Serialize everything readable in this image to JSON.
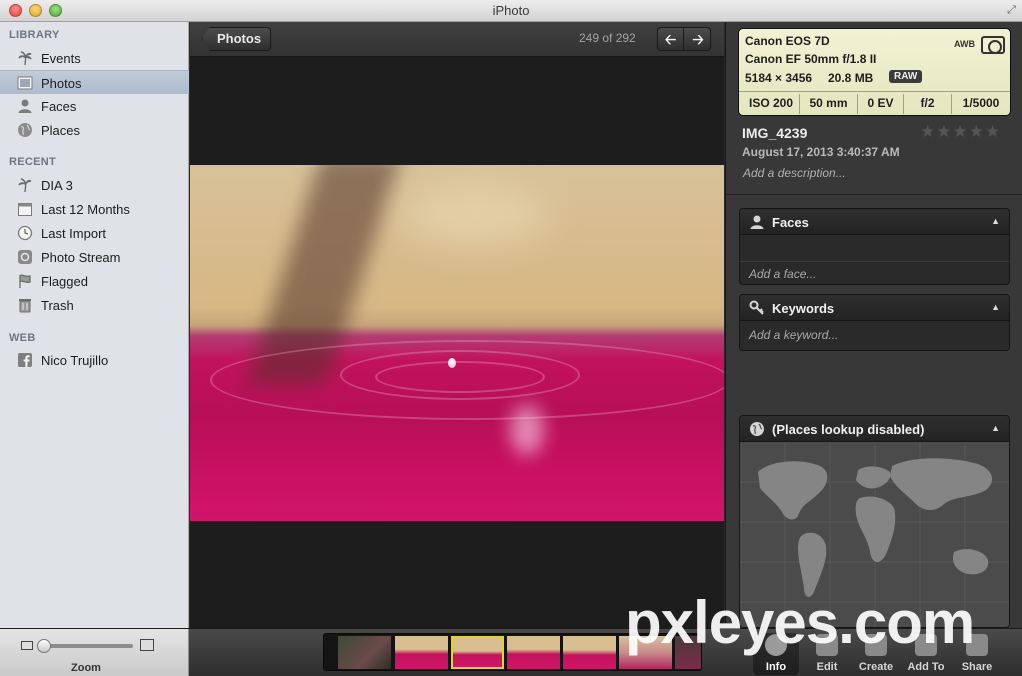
{
  "window": {
    "title": "iPhoto"
  },
  "sidebar": {
    "sections": [
      {
        "label": "LIBRARY"
      },
      {
        "label": "RECENT"
      },
      {
        "label": "WEB"
      }
    ],
    "library": [
      {
        "label": "Events",
        "icon": "palm-tree-icon"
      },
      {
        "label": "Photos",
        "icon": "photo-icon",
        "selected": true
      },
      {
        "label": "Faces",
        "icon": "person-icon"
      },
      {
        "label": "Places",
        "icon": "globe-icon"
      }
    ],
    "recent": [
      {
        "label": "DIA 3",
        "icon": "palm-tree-icon"
      },
      {
        "label": "Last 12 Months",
        "icon": "calendar-icon"
      },
      {
        "label": "Last Import",
        "icon": "clock-icon"
      },
      {
        "label": "Photo Stream",
        "icon": "photo-stream-icon"
      },
      {
        "label": "Flagged",
        "icon": "flag-icon"
      },
      {
        "label": "Trash",
        "icon": "trash-icon"
      }
    ],
    "web": [
      {
        "label": "Nico Trujillo",
        "icon": "facebook-icon"
      }
    ]
  },
  "viewer": {
    "back_label": "Photos",
    "counter": "249 of 292"
  },
  "info": {
    "camera": "Canon EOS 7D",
    "lens": "Canon EF 50mm f/1.8 II",
    "dimensions": "5184 × 3456",
    "file_size": "20.8 MB",
    "format_badge": "RAW",
    "white_balance": "AWB",
    "iso": "ISO 200",
    "focal_length": "50 mm",
    "exposure_bias": "0 EV",
    "aperture": "f/2",
    "shutter": "1/5000",
    "name": "IMG_4239",
    "rating_stars": "★★★★★",
    "date": "August 17, 2013 3:40:37 AM",
    "description_placeholder": "Add a description...",
    "faces": {
      "title": "Faces",
      "hint": "Add a face..."
    },
    "keywords": {
      "title": "Keywords",
      "hint": "Add a keyword..."
    },
    "places": {
      "title": "(Places lookup disabled)"
    }
  },
  "bottom": {
    "zoom_label": "Zoom",
    "zoom_level": 0.05,
    "toolbar": [
      {
        "label": "Info",
        "icon": "info-icon",
        "active": true
      },
      {
        "label": "Edit",
        "icon": "edit-icon"
      },
      {
        "label": "Create",
        "icon": "create-icon"
      },
      {
        "label": "Add To",
        "icon": "add-to-icon"
      },
      {
        "label": "Share",
        "icon": "share-icon"
      }
    ]
  },
  "watermark": "pxleyes.com",
  "colors": {
    "selection": "#aebbcd",
    "exif_bg": "#e4e6bf",
    "current_thumb": "#e1d52b"
  }
}
